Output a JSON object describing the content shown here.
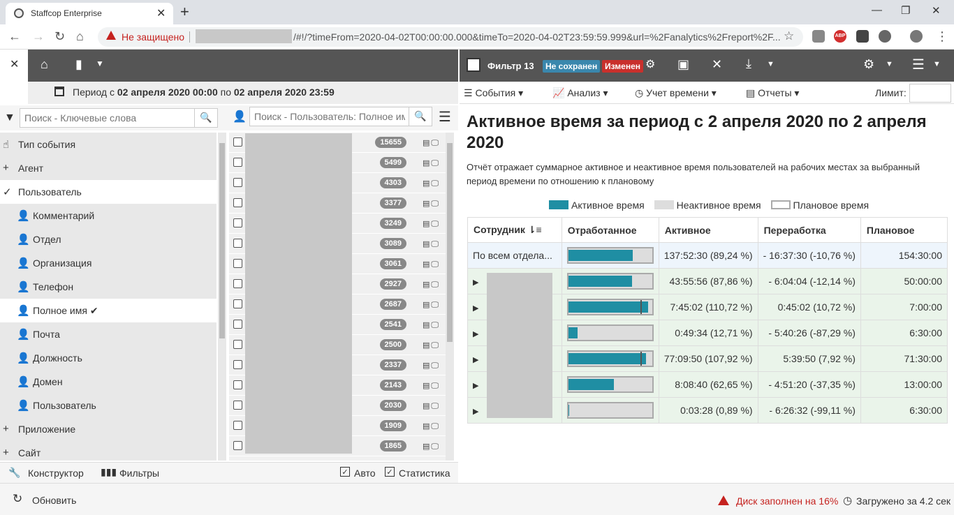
{
  "browser": {
    "tab_title": "Staffcop Enterprise",
    "not_secure": "Не защищено",
    "url": "/#!/?timeFrom=2020-04-02T00:00:00.000&timeTo=2020-04-02T23:59:59.999&url=%2Fanalytics%2Freport%2F...",
    "ext_abp": "ABP"
  },
  "header": {
    "period_prefix": "Период с ",
    "period_from": "02 апреля 2020 00:00",
    "period_mid": " по ",
    "period_to": "02 апреля 2020 23:59"
  },
  "left": {
    "search_placeholder": "Поиск - Ключевые слова",
    "user_search_placeholder": "Поиск - Пользователь: Полное им",
    "filters": [
      {
        "label": "Тип события",
        "icon": "thumb",
        "selected": false,
        "sub": false
      },
      {
        "label": "Агент",
        "icon": "plus",
        "selected": false,
        "sub": false
      },
      {
        "label": "Пользователь",
        "icon": "check",
        "selected": true,
        "sub": false
      },
      {
        "label": "Комментарий",
        "icon": "person",
        "selected": false,
        "sub": true
      },
      {
        "label": "Отдел",
        "icon": "person",
        "selected": false,
        "sub": true
      },
      {
        "label": "Организация",
        "icon": "person",
        "selected": false,
        "sub": true
      },
      {
        "label": "Телефон",
        "icon": "person",
        "selected": false,
        "sub": true
      },
      {
        "label": "Полное имя ✔",
        "icon": "person",
        "selected": true,
        "sub": true
      },
      {
        "label": "Почта",
        "icon": "person",
        "selected": false,
        "sub": true
      },
      {
        "label": "Должность",
        "icon": "person",
        "selected": false,
        "sub": true
      },
      {
        "label": "Домен",
        "icon": "person",
        "selected": false,
        "sub": true
      },
      {
        "label": "Пользователь",
        "icon": "person",
        "selected": false,
        "sub": true
      },
      {
        "label": "Приложение",
        "icon": "plus",
        "selected": false,
        "sub": false
      },
      {
        "label": "Сайт",
        "icon": "plus",
        "selected": false,
        "sub": false
      }
    ],
    "user_counts": [
      "15655",
      "5499",
      "4303",
      "3377",
      "3249",
      "3089",
      "3061",
      "2927",
      "2687",
      "2541",
      "2500",
      "2337",
      "2143",
      "2030",
      "1909",
      "1865"
    ],
    "tab_constructor": "Конструктор",
    "tab_filters": "Фильтры",
    "chk_auto": "Авто",
    "chk_stats": "Статистика"
  },
  "status": {
    "refresh": "Обновить",
    "disk": "Диск заполнен на 16%",
    "loaded": "Загружено за 4.2 сек"
  },
  "right": {
    "filter_name": "Фильтр 13",
    "badge_unsaved": "Не сохранен",
    "badge_changed": "Изменен",
    "menu_events": "События",
    "menu_analysis": "Анализ",
    "menu_time": "Учет времени",
    "menu_reports": "Отчеты",
    "limit_label": "Лимит:",
    "report_title": "Активное время за период с 2 апреля 2020 по 2 апреля 2020",
    "report_desc": "Отчёт отражает суммарное активное и неактивное время пользователей на рабочих местах за выбранный период времени по отношению к плановому",
    "legend_active": "Активное время",
    "legend_inactive": "Неактивное время",
    "legend_plan": "Плановое время",
    "colors": {
      "active": "#1f8ea3",
      "inactive": "#dddddd",
      "plan": "#aaaaaa"
    },
    "columns": [
      "Сотрудник",
      "Отработанное",
      "Активное",
      "Переработка",
      "Плановое"
    ],
    "total_row": {
      "name": "По всем отдела...",
      "active": "137:52:30 (89,24 %)",
      "overtime": "- 16:37:30 (-10,76 %)",
      "plan": "154:30:00",
      "fill": 0.8924
    },
    "rows": [
      {
        "active": "43:55:56 (87,86 %)",
        "overtime": "- 6:04:04 (-12,14 %)",
        "plan": "50:00:00",
        "fill": 0.8786
      },
      {
        "active": "7:45:02 (110,72 %)",
        "overtime": "0:45:02 (10,72 %)",
        "plan": "7:00:00",
        "fill": 1.1072
      },
      {
        "active": "0:49:34 (12,71 %)",
        "overtime": "- 5:40:26 (-87,29 %)",
        "plan": "6:30:00",
        "fill": 0.1271
      },
      {
        "active": "77:09:50 (107,92 %)",
        "overtime": "5:39:50 (7,92 %)",
        "plan": "71:30:00",
        "fill": 1.0792
      },
      {
        "active": "8:08:40 (62,65 %)",
        "overtime": "- 4:51:20 (-37,35 %)",
        "plan": "13:00:00",
        "fill": 0.6265
      },
      {
        "active": "0:03:28 (0,89 %)",
        "overtime": "- 6:26:32 (-99,11 %)",
        "plan": "6:30:00",
        "fill": 0.0089
      }
    ]
  }
}
